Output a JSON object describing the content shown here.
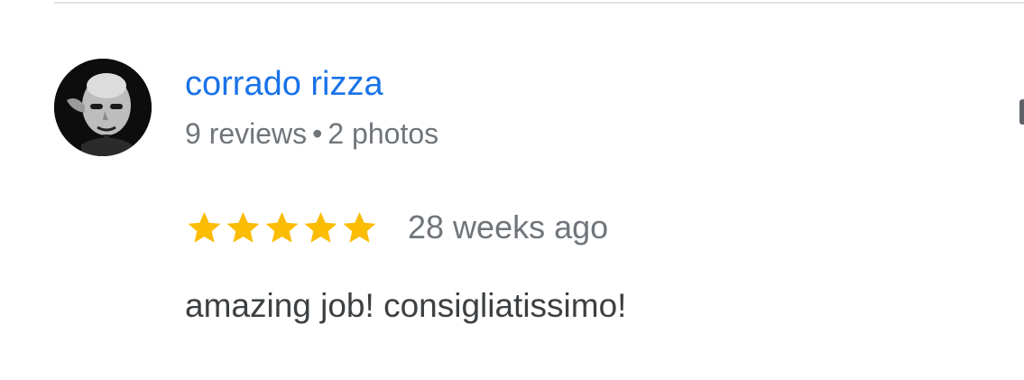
{
  "review": {
    "author": {
      "name": "corrado rizza",
      "reviews_count": "9 reviews",
      "separator": "•",
      "photos_count": "2 photos",
      "avatar_icon": "person-portrait-avatar"
    },
    "rating": {
      "stars": 5,
      "max_stars": 5,
      "star_color": "#fbbc04",
      "star_icon": "star-icon"
    },
    "time_ago": "28 weeks ago",
    "text": "amazing job! consigliatissimo!"
  },
  "colors": {
    "name_link": "#1a73e8",
    "secondary_text": "#70757a",
    "body_text": "#3c4043"
  }
}
